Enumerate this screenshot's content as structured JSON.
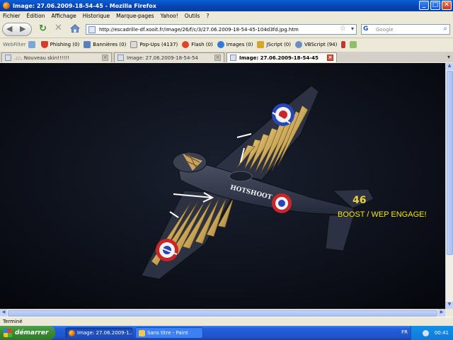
{
  "window": {
    "title": "Image: 27.06.2009-18-54-45 - Mozilla Firefox",
    "btn_min": "_",
    "btn_max": "□",
    "btn_close": "✕"
  },
  "menu": [
    "Fichier",
    "Édition",
    "Affichage",
    "Historique",
    "Marque-pages",
    "Yahoo!",
    "Outils",
    "?"
  ],
  "nav": {
    "url": "http://escadrille-df.xooit.fr/image/26/f/c/3/27.06.2009-18-54-45-104d3fd.jpg.htm",
    "search_placeholder": "Google"
  },
  "toolbar": {
    "webfilter": "WebFilter",
    "phishing": "Phishing (0)",
    "bannieres": "Bannières (0)",
    "popups": "Pop-Ups (4137)",
    "flash": "Flash (0)",
    "images": "Images (0)",
    "jscript": "JScript (0)",
    "vbscript": "VBScript (94)"
  },
  "tabs": [
    {
      "label": ".:::. Nouveau skin!!!!!!",
      "active": false
    },
    {
      "label": "Image: 27.06.2009-18-54-54",
      "active": false
    },
    {
      "label": "Image: 27.06.2009-18-54-45",
      "active": true
    }
  ],
  "image": {
    "fuselage_text": "HOTSHOOT",
    "tail_number": "46",
    "overlay_text": "BOOST / WEP ENGAGE!"
  },
  "status": "Terminé",
  "taskbar": {
    "start": "démarrer",
    "tasks": [
      {
        "label": "Image: 27.06.2009-1...",
        "active": true
      },
      {
        "label": "Sans titre - Paint",
        "active": false
      }
    ],
    "lang": "FR",
    "clock": "00:41"
  },
  "colors": {
    "title_blue": "#0843b0",
    "taskbar_blue": "#245edb",
    "start_green": "#3b8d37",
    "overlay_yellow": "#f5e800"
  }
}
